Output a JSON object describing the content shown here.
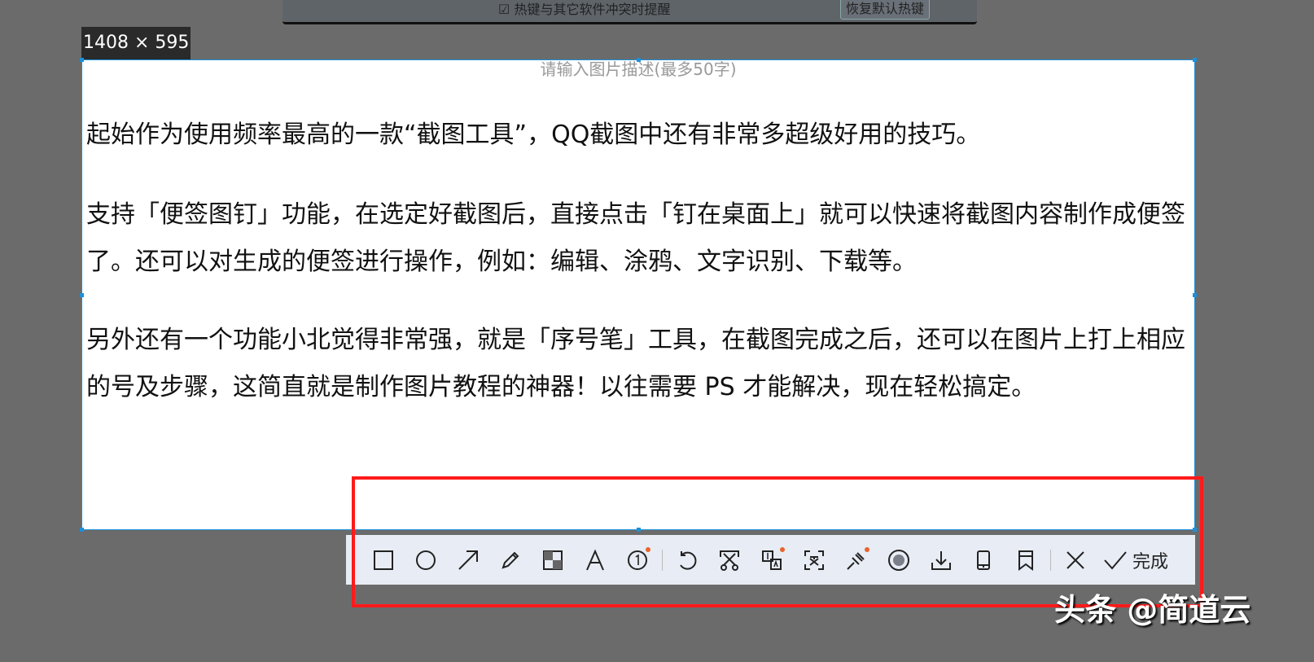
{
  "background_window": {
    "checkbox_label": "热键与其它软件冲突时提醒",
    "reset_button": "恢复默认热键"
  },
  "selection_size": "1408 × 595",
  "description_placeholder": "请输入图片描述(最多50字)",
  "paragraphs": [
    "起始作为使用频率最高的一款“截图工具”，QQ截图中还有非常多超级好用的技巧。",
    "支持「便签图钉」功能，在选定好截图后，直接点击「钉在桌面上」就可以快速将截图内容制作成便签了。还可以对生成的便签进行操作，例如：编辑、涂鸦、文字识别、下载等。",
    "另外还有一个功能小北觉得非常强，就是「序号笔」工具，在截图完成之后，还可以在图片上打上相应的号及步骤，这简直就是制作图片教程的神器！以往需要 PS 才能解决，现在轻松搞定。"
  ],
  "toolbar": {
    "done_label": "完成"
  },
  "watermark": "头条 @简道云",
  "colors": {
    "accent": "#1e90d8",
    "highlight": "#ff1a1a",
    "badge": "#e8642b"
  }
}
